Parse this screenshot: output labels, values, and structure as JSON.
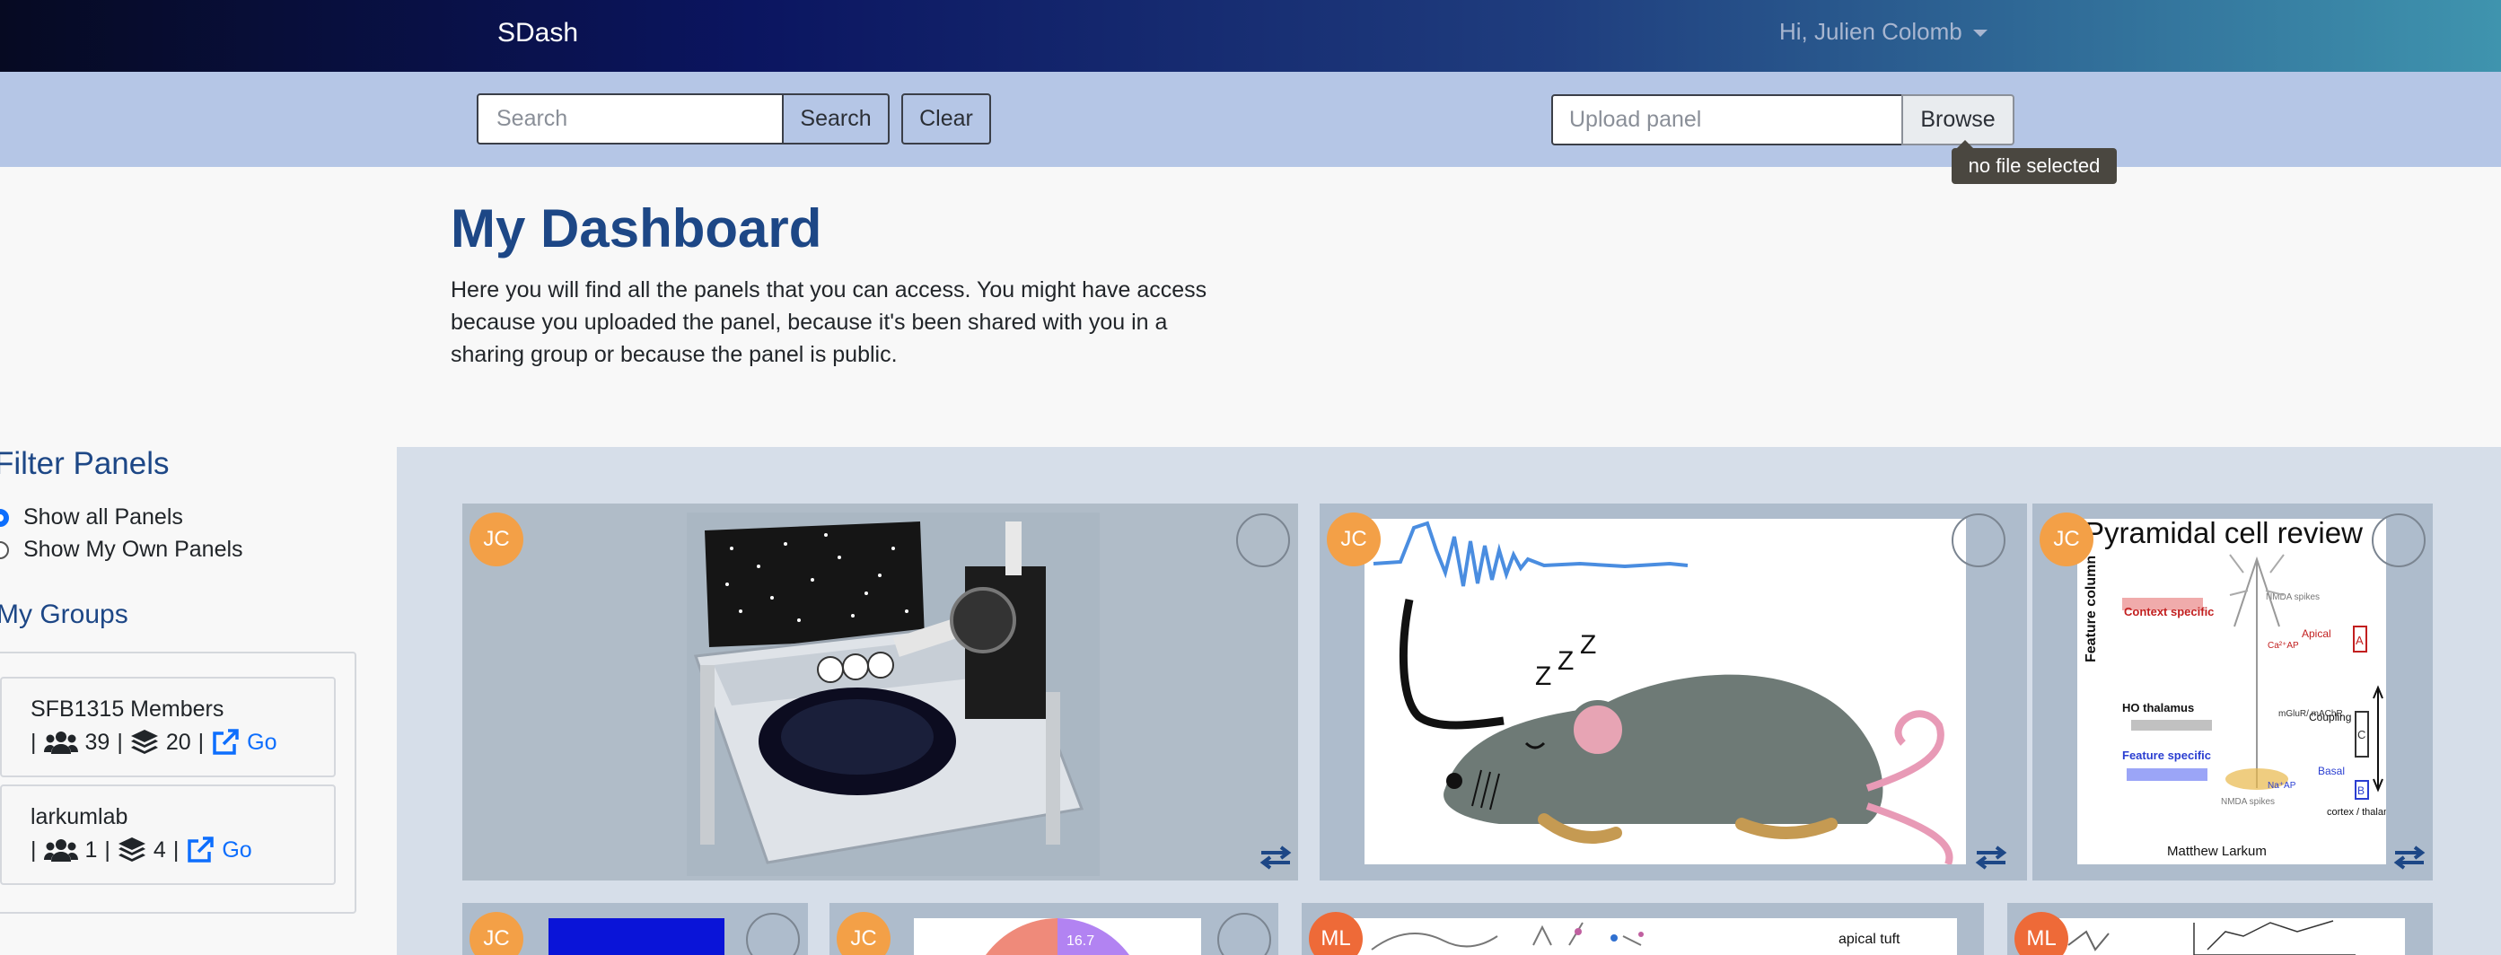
{
  "navbar": {
    "brand": "SDash",
    "user_greeting": "Hi, Julien Colomb"
  },
  "toolbar": {
    "search_placeholder": "Search",
    "search_button": "Search",
    "clear_button": "Clear",
    "upload_placeholder": "Upload panel",
    "browse_button": "Browse",
    "file_tooltip": "no file selected"
  },
  "intro": {
    "title": "My Dashboard",
    "description": "Here you will find all the panels that you can access. You might have access because you uploaded the panel, because it's been shared with you in a sharing group or because the panel is public."
  },
  "filter": {
    "title": "Filter Panels",
    "options": [
      {
        "label": "Show all Panels",
        "checked": true
      },
      {
        "label": "Show My Own Panels",
        "checked": false
      }
    ]
  },
  "groups": {
    "title": "My Groups",
    "items": [
      {
        "name": "SFB1315 Members",
        "members": "39",
        "panels": "20",
        "link": "Go"
      },
      {
        "name": "larkumlab",
        "members": "1",
        "panels": "4",
        "link": "Go"
      }
    ]
  },
  "panels": [
    {
      "owner": "JC",
      "content": "behavioral setup rendering"
    },
    {
      "owner": "JC",
      "content": "sleeping mouse EEG illustration"
    },
    {
      "owner": "JC",
      "title": "Pyramidal cell review",
      "author": "Matthew Larkum",
      "labels": {
        "feature_column": "Feature column",
        "context": "Context specific",
        "apical": "Apical",
        "ca_ap": "Ca²⁺AP",
        "ho_thalamus": "HO thalamus",
        "coupling": "Coupling",
        "feature_specific": "Feature specific",
        "basal": "Basal",
        "na_ap": "Na⁺AP",
        "cortex": "cortex / thalamus",
        "mglur": "mGluR/ mAChR",
        "nmda_top": "NMDA spikes",
        "nmda_bottom": "NMDA spikes",
        "a": "A",
        "c": "C",
        "b": "B"
      }
    },
    {
      "owner": "JC"
    },
    {
      "owner": "JC",
      "pie_label": "16.7"
    },
    {
      "owner": "ML",
      "label": "apical tuft"
    },
    {
      "owner": "ML"
    }
  ]
}
